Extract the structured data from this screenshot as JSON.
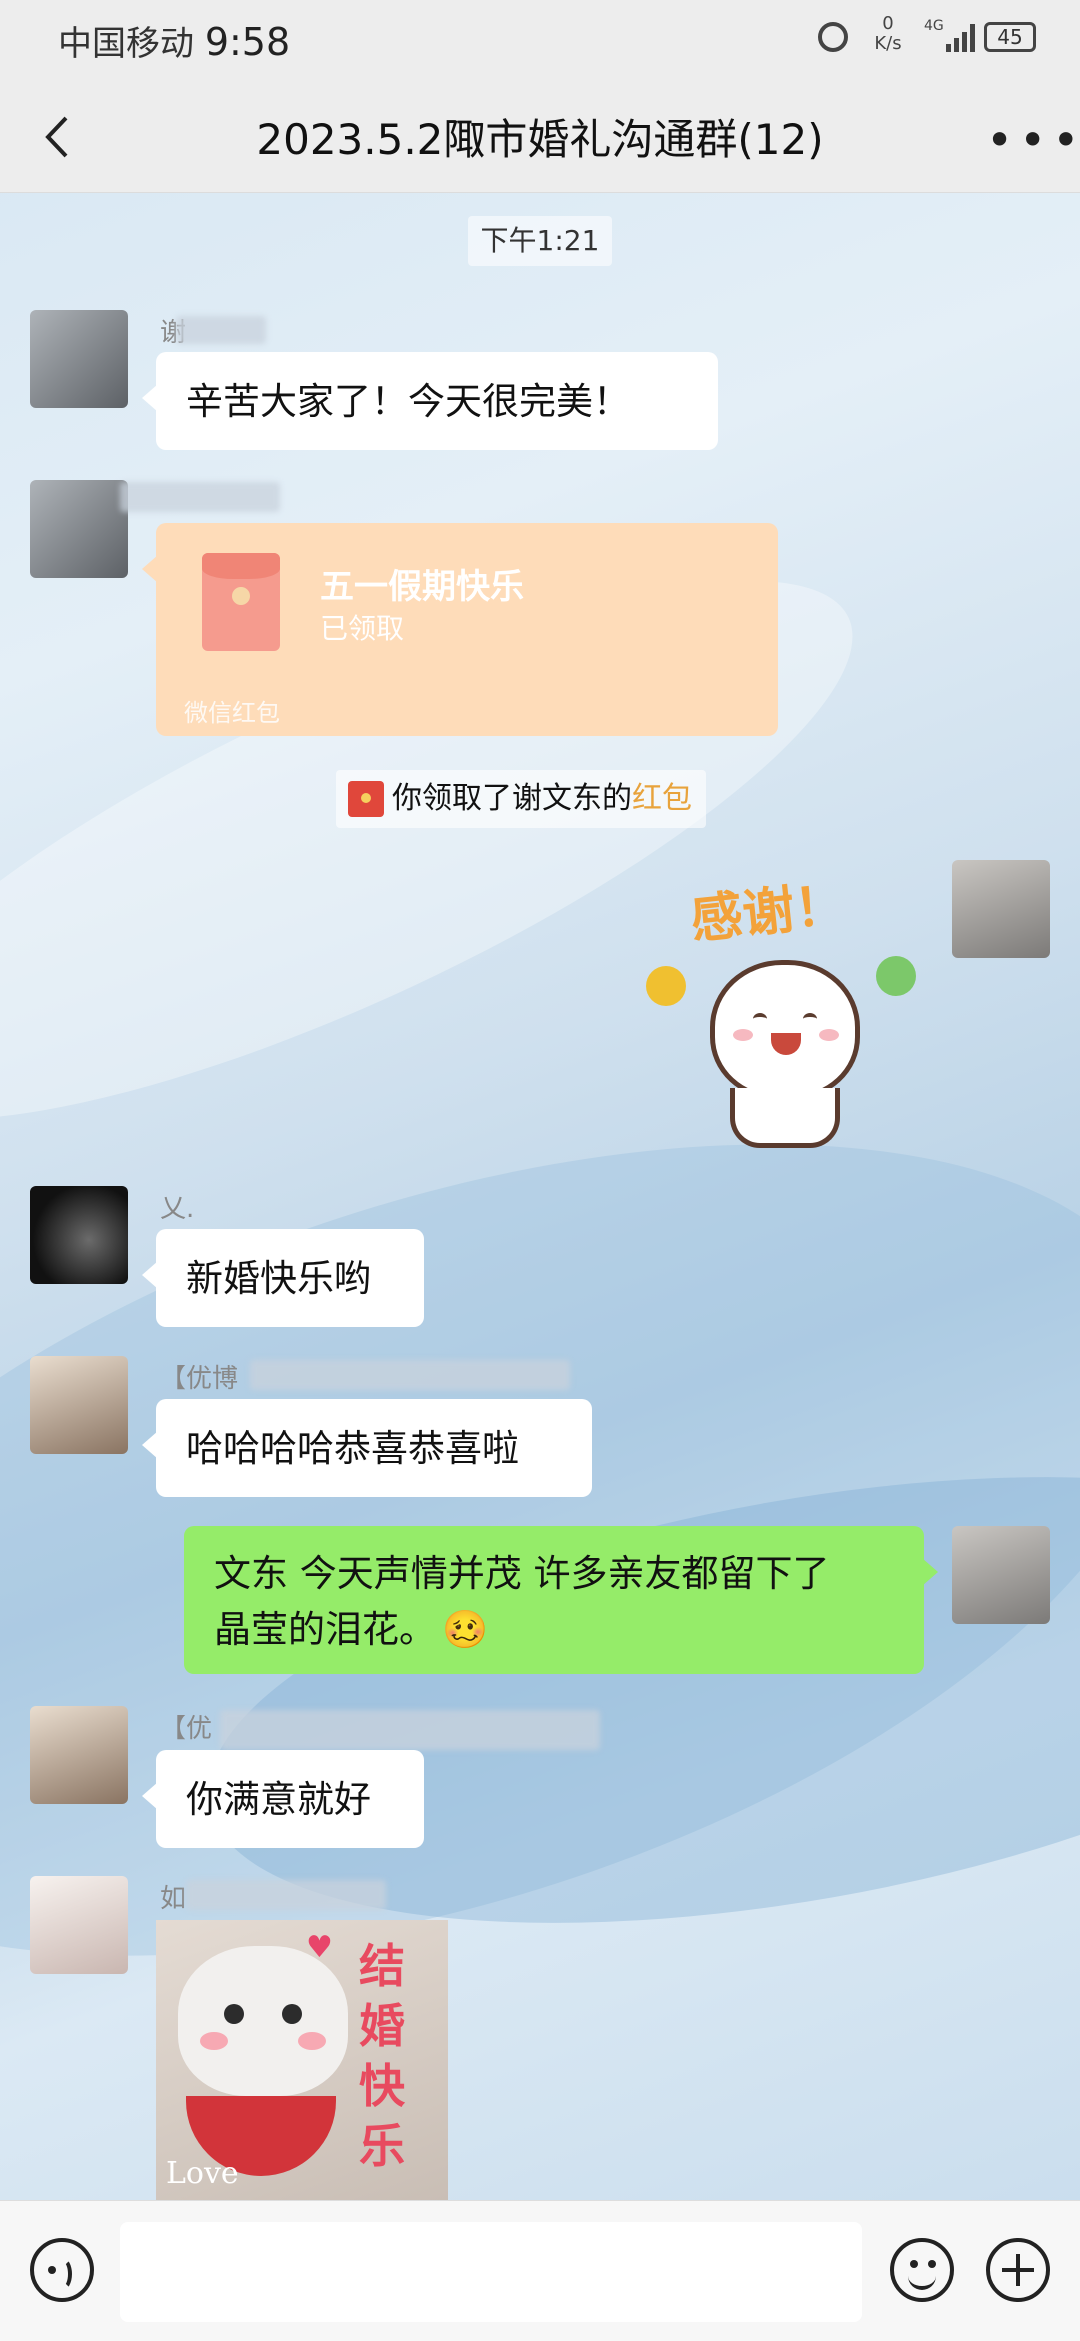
{
  "status_bar": {
    "carrier": "中国移动",
    "time": "9:58",
    "net_speed_value": "0",
    "net_speed_unit": "K/s",
    "network": "4G",
    "battery": "45"
  },
  "header": {
    "title": "2023.5.2陬市婚礼沟通群(12)",
    "back_icon": "chevron-left-icon",
    "more_icon": "ellipsis-icon"
  },
  "chat": {
    "timestamp": "下午1:21",
    "messages": [
      {
        "type": "text",
        "side": "left",
        "sender": "谢",
        "text": "辛苦大家了！今天很完美！"
      },
      {
        "type": "red_packet",
        "side": "left",
        "title": "五一假期快乐",
        "status": "已领取",
        "footer": "微信红包"
      },
      {
        "type": "system",
        "text": "你领取了谢文东的",
        "highlight": "红包"
      },
      {
        "type": "sticker",
        "side": "right",
        "text": "感谢！"
      },
      {
        "type": "text",
        "side": "left",
        "sender": "乂.",
        "text": "新婚快乐哟"
      },
      {
        "type": "text",
        "side": "left",
        "sender": "【优博",
        "text": "哈哈哈哈恭喜恭喜啦"
      },
      {
        "type": "text",
        "side": "right",
        "text_line1": "文东 今天声情并茂 许多亲友都留下了",
        "text_line2": "晶莹的泪花。",
        "emoji": "🥴"
      },
      {
        "type": "text",
        "side": "left",
        "sender": "【优",
        "text": "你满意就好"
      },
      {
        "type": "image",
        "side": "left",
        "sender": "如",
        "caption": "结婚快乐",
        "corner": "Love"
      }
    ]
  },
  "input_bar": {
    "voice_icon": "voice-icon",
    "emoji_icon": "smiley-icon",
    "plus_icon": "plus-icon"
  },
  "colors": {
    "bubble_green": "#95ec69",
    "red_packet": "#fedcb9",
    "highlight": "#e8a33c"
  }
}
